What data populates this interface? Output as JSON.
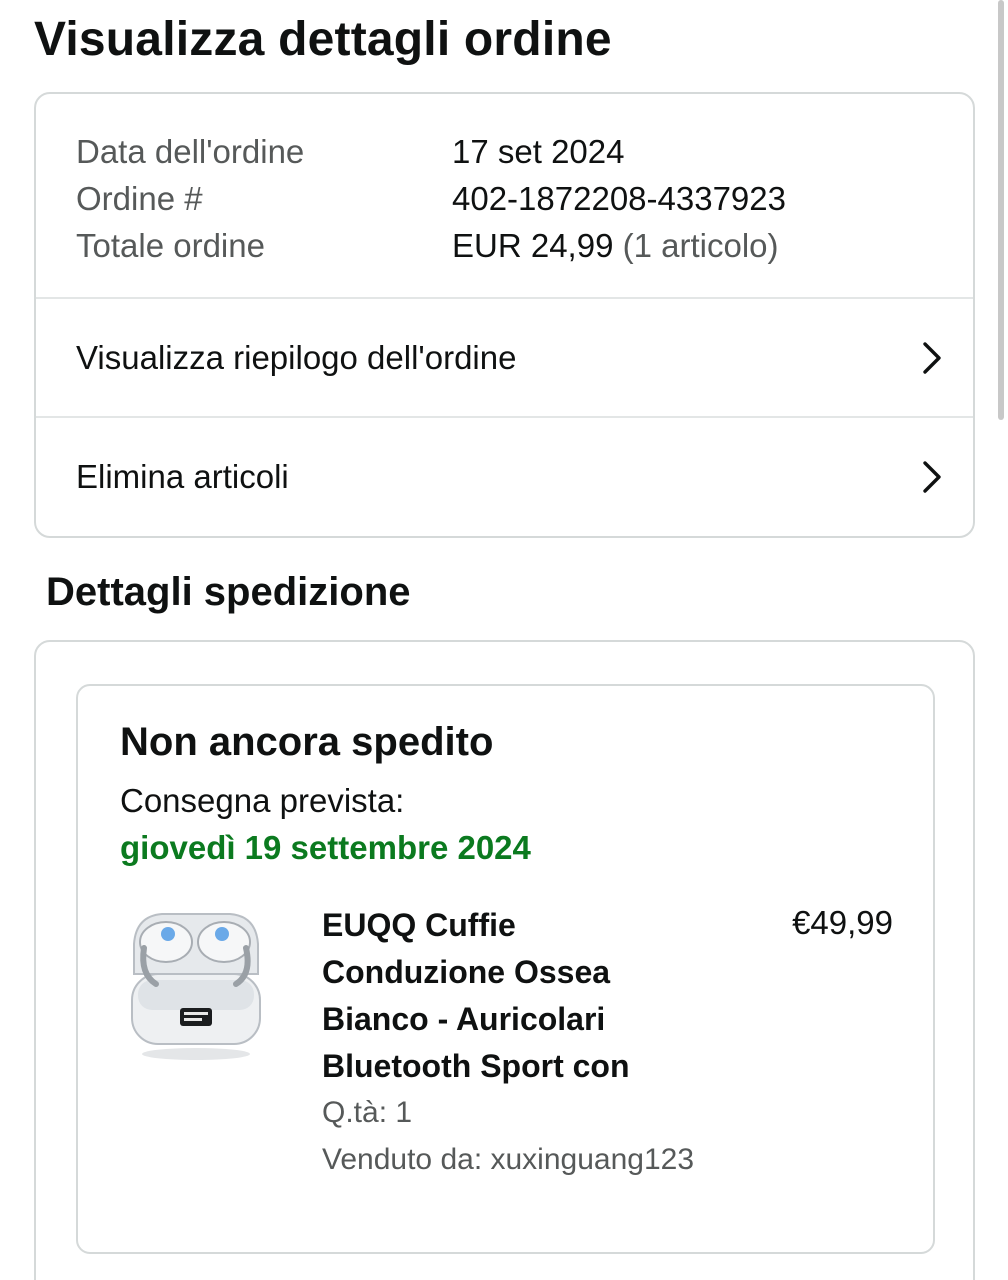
{
  "page": {
    "title": "Visualizza dettagli ordine"
  },
  "order": {
    "date_label": "Data dell'ordine",
    "date_value": "17 set 2024",
    "number_label": "Ordine #",
    "number_value": "402-1872208-4337923",
    "total_label": "Totale ordine",
    "total_value": "EUR 24,99",
    "total_items": "(1 articolo)"
  },
  "links": {
    "summary": "Visualizza riepilogo dell'ordine",
    "delete_items": "Elimina articoli"
  },
  "shipping": {
    "section_title": "Dettagli spedizione",
    "status": "Non ancora spedito",
    "delivery_label": "Consegna prevista:",
    "delivery_date": "giovedì 19 settembre 2024",
    "delivery_date_color": "#0b7a1f"
  },
  "product": {
    "title": "EUQQ Cuffie Conduzione Ossea Bianco - Auricolari Bluetooth Sport con",
    "price": "€49,99",
    "quantity": "Q.tà: 1",
    "seller": "Venduto da: xuxinguang123",
    "image_icon": "earbuds-product-image"
  },
  "icons": {
    "chevron": "chevron-right-icon"
  }
}
